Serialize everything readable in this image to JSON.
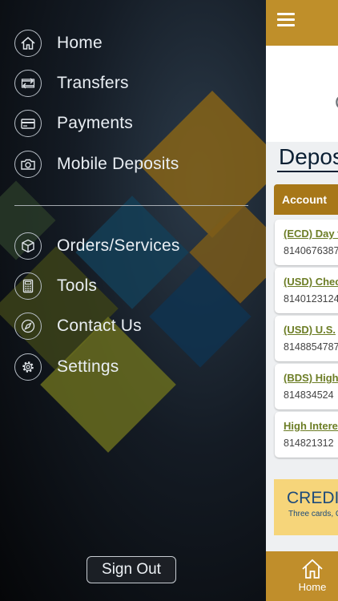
{
  "menu": {
    "group1": [
      {
        "label": "Home",
        "icon": "home-icon"
      },
      {
        "label": "Transfers",
        "icon": "transfer-icon"
      },
      {
        "label": "Payments",
        "icon": "card-icon"
      },
      {
        "label": "Mobile Deposits",
        "icon": "camera-icon"
      }
    ],
    "group2": [
      {
        "label": "Orders/Services",
        "icon": "box-icon"
      },
      {
        "label": "Tools",
        "icon": "calculator-icon"
      },
      {
        "label": "Contact Us",
        "icon": "compass-icon"
      },
      {
        "label": "Settings",
        "icon": "gear-icon"
      }
    ]
  },
  "sign_out": "Sign Out",
  "content": {
    "logo_fragment": "C",
    "title": "Depos",
    "table_header": "Account",
    "accounts": [
      {
        "name": "(ECD) Day t",
        "number": "8140676387"
      },
      {
        "name": "(USD) Chec",
        "number": "8140123124"
      },
      {
        "name": "(USD) U.S.",
        "number": "8148854787"
      },
      {
        "name": "(BDS) High",
        "number": "814834524"
      },
      {
        "name": "High Interes",
        "number": "814821312"
      }
    ],
    "promo": {
      "title": "CREDIT",
      "subtitle": "Three cards, C"
    },
    "bottom_nav": {
      "home_label": "Home"
    }
  },
  "colors": {
    "accent": "#bf8f2a",
    "header": "#a77718",
    "link": "#6c7d25"
  }
}
